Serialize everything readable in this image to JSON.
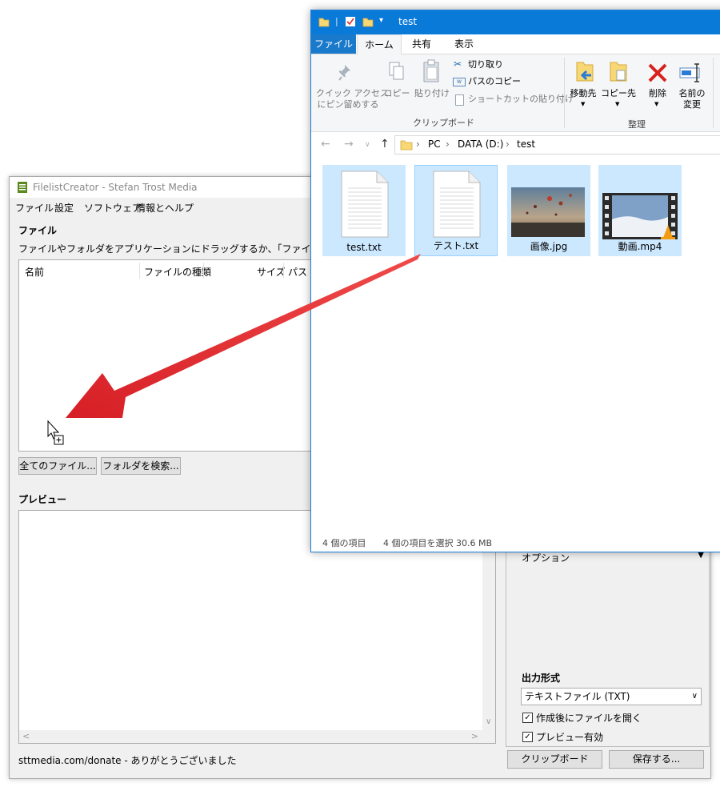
{
  "filelistcreator": {
    "title": "FilelistCreator - Stefan Trost Media",
    "menu": [
      "ファイル",
      "設定",
      "ソフトウェア",
      "情報とヘルプ"
    ],
    "files_label": "ファイル",
    "instruction": "ファイルやフォルダをアプリケーションにドラッグするか、「ファイルの追加/フォルダの検",
    "columns": [
      "名前",
      "ファイルの種類",
      "サイズ",
      "パス"
    ],
    "btn_all_files": "全てのファイル...",
    "btn_search_folder": "フォルダを検索...",
    "preview_label": "プレビュー",
    "options_label": "オプション",
    "output_format_label": "出力形式",
    "output_format_value": "テキストファイル (TXT)",
    "open_after_label": "作成後にファイルを開く",
    "open_after_checked": true,
    "preview_enabled_label": "プレビュー有効",
    "preview_enabled_checked": true,
    "footer_text": "sttmedia.com/donate - ありがとうございました",
    "btn_clipboard": "クリップボード",
    "btn_save": "保存する..."
  },
  "explorer": {
    "title": "test",
    "tabs": [
      "ファイル",
      "ホーム",
      "共有",
      "表示"
    ],
    "ribbon": {
      "pin_label_1": "クイック アクセス",
      "pin_label_2": "にピン留めする",
      "copy_label": "コピー",
      "paste_label": "貼り付け",
      "cut_label": "切り取り",
      "copy_path_label": "パスのコピー",
      "paste_shortcut_label": "ショートカットの貼り付け",
      "clipboard_group": "クリップボード",
      "move_to_label": "移動先",
      "copy_to_label": "コピー先",
      "delete_label": "削除",
      "rename_label_1": "名前の",
      "rename_label_2": "変更",
      "organize_group": "整理"
    },
    "breadcrumb": [
      "PC",
      "DATA (D:)",
      "test"
    ],
    "files": [
      {
        "name": "test.txt",
        "icon": "text-file-icon"
      },
      {
        "name": "テスト.txt",
        "icon": "text-file-icon"
      },
      {
        "name": "画像.jpg",
        "icon": "image-thumbnail"
      },
      {
        "name": "動画.mp4",
        "icon": "video-thumbnail"
      }
    ],
    "status_count": "4 個の項目",
    "status_selected": "4 個の項目を選択  30.6 MB"
  },
  "colors": {
    "explorer_title_bg": "#0a7ad9",
    "selection_bg": "#cce8ff",
    "arrow_red": "#e0282e"
  }
}
